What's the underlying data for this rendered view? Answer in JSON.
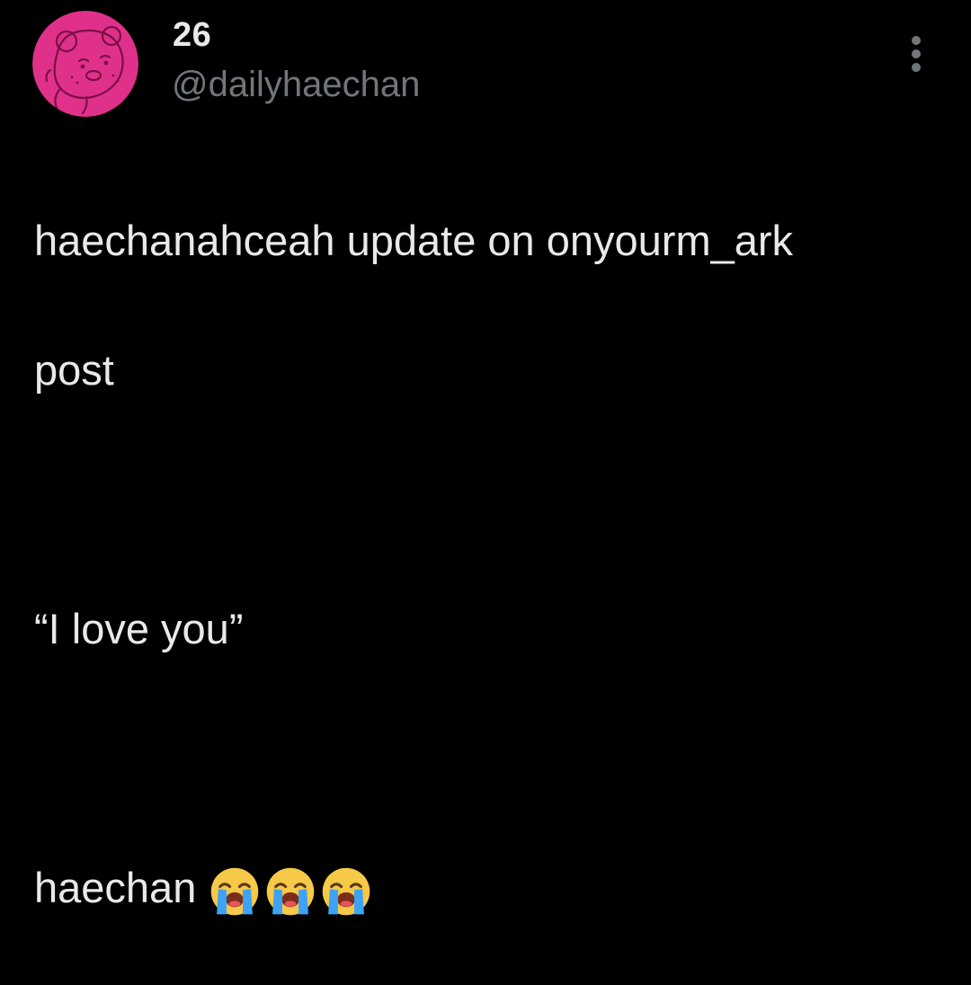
{
  "post": {
    "author": {
      "display_name": "26",
      "handle": "@dailyhaechan",
      "avatar_color": "#e0318a"
    },
    "text": {
      "line1": "haechanahceah update on onyourm_ark",
      "line2": "post",
      "line3": "“I love you”",
      "line4": "haechan"
    },
    "emojis": [
      "loudly-crying-face-icon",
      "loudly-crying-face-icon",
      "loudly-crying-face-icon"
    ],
    "more_icon": "more-vertical-icon"
  },
  "colors": {
    "background": "#000000",
    "primary_text": "#e7e9ea",
    "secondary_text": "#71767b"
  }
}
